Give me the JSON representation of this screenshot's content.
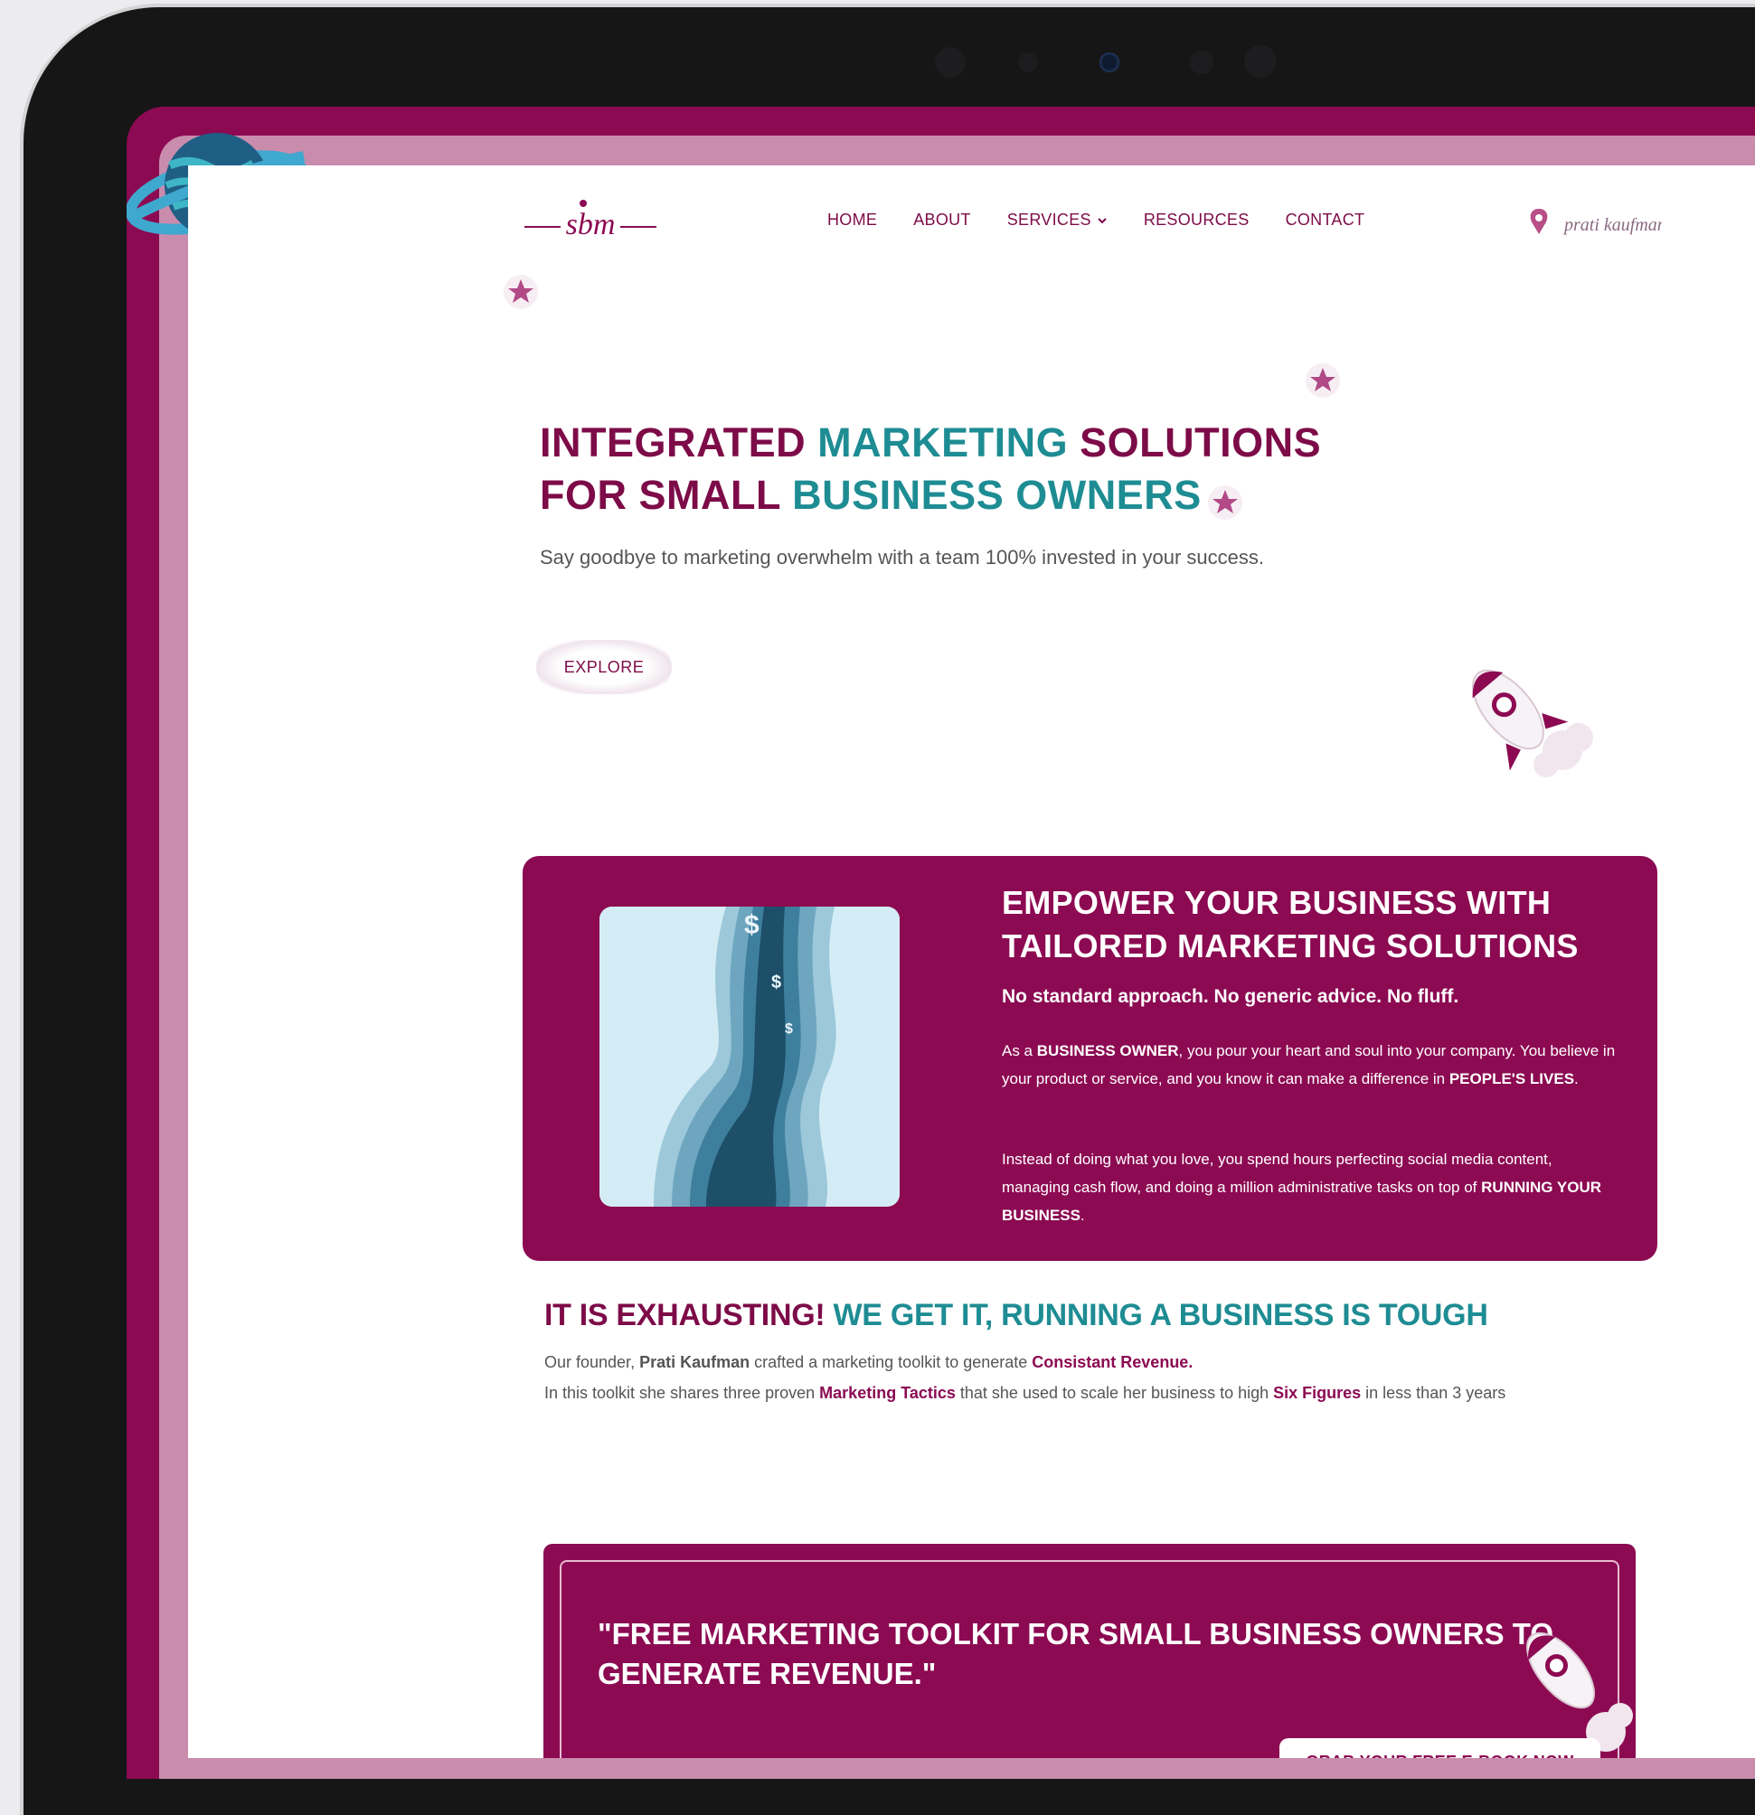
{
  "brand": {
    "logo_text": "sbm",
    "accent_color": "#8c0a52",
    "teal_color": "#1e8c93"
  },
  "nav": {
    "items": [
      {
        "label": "HOME"
      },
      {
        "label": "ABOUT"
      },
      {
        "label": "SERVICES"
      },
      {
        "label": "RESOURCES"
      },
      {
        "label": "CONTACT"
      }
    ],
    "signature_text": "prati kaufman"
  },
  "hero": {
    "title_line1_part1": "INTEGRATED ",
    "title_line1_part2": "MARKETING",
    "title_line1_part3": " SOLUTIONS",
    "title_line2_part1": "FOR SMALL ",
    "title_line2_part2": "BUSINESS OWNERS",
    "subtitle": "Say goodbye to marketing overwhelm with a team 100% invested in your success.",
    "cta_label": "EXPLORE"
  },
  "empower": {
    "title": "EMPOWER YOUR BUSINESS WITH TAILORED MARKETING SOLUTIONS",
    "lead": "No standard approach. No generic advice. No fluff.",
    "p1_a": "As a ",
    "p1_b": "BUSINESS OWNER",
    "p1_c": ", you pour your heart and soul into your company. You believe in your product or service, and you know it can make a difference in ",
    "p1_d": "PEOPLE'S LIVES",
    "p1_e": ".",
    "p2_a": "Instead of doing what you love, you spend hours perfecting social media content, managing cash flow, and doing a million administrative tasks on top of ",
    "p2_b": "RUNNING YOUR BUSINESS",
    "p2_c": "."
  },
  "exhausting": {
    "title_part1": "IT IS EXHAUSTING! ",
    "title_part2": "WE GET IT, RUNNING A BUSINESS IS TOUGH",
    "l1_a": "Our founder, ",
    "l1_b": "Prati Kaufman",
    "l1_c": " crafted a marketing toolkit to generate ",
    "l1_d": "Consistant Revenue.",
    "l2_a": "In this toolkit she shares three proven ",
    "l2_b": "Marketing Tactics",
    "l2_c": " that she used to scale her business to high ",
    "l2_d": "Six Figures",
    "l2_e": " in less than 3 years"
  },
  "toolkit": {
    "title": "\"FREE MARKETING TOOLKIT FOR SMALL BUSINESS OWNERS TO GENERATE REVENUE.\"",
    "cta_label": "GRAB YOUR FREE E-BOOK NOW"
  },
  "icons": [
    "planet-icon",
    "star-icon",
    "rocket-icon",
    "chevron-down-icon",
    "map-pin-icon"
  ]
}
